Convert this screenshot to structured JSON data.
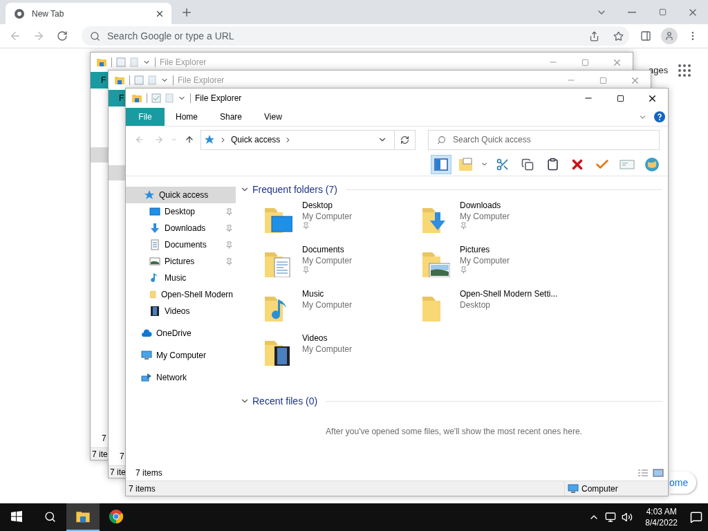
{
  "browser": {
    "tab": {
      "title": "New Tab"
    },
    "omnibox": {
      "placeholder": "Search Google or type a URL"
    }
  },
  "page": {
    "link_fragment": "ages",
    "button_fragment": "ome"
  },
  "back_windows": [
    {
      "title": "File Explorer",
      "tab": "F",
      "item_count": "7",
      "status": "7 ite"
    },
    {
      "title": "File Explorer",
      "tab": "F",
      "item_count": "7",
      "status": "7 ite"
    }
  ],
  "window": {
    "title": "File Explorer",
    "ribbon_tabs": [
      {
        "label": "File",
        "selected": true
      },
      {
        "label": "Home",
        "selected": false
      },
      {
        "label": "Share",
        "selected": false
      },
      {
        "label": "View",
        "selected": false
      }
    ],
    "address": {
      "path": "Quick access"
    },
    "search": {
      "placeholder": "Search Quick access"
    },
    "preview_pane": {
      "on": true
    },
    "nav": [
      {
        "label": "Quick access",
        "kind": "star",
        "selected": true,
        "children": [
          {
            "label": "Desktop",
            "kind": "desktop",
            "pinned": true
          },
          {
            "label": "Downloads",
            "kind": "downloads",
            "pinned": true
          },
          {
            "label": "Documents",
            "kind": "documents",
            "pinned": true
          },
          {
            "label": "Pictures",
            "kind": "pictures",
            "pinned": true
          },
          {
            "label": "Music",
            "kind": "music",
            "pinned": false
          },
          {
            "label": "Open-Shell Modern",
            "kind": "folder",
            "pinned": false
          },
          {
            "label": "Videos",
            "kind": "videos",
            "pinned": false
          }
        ]
      },
      {
        "label": "OneDrive",
        "kind": "cloud",
        "selected": false
      },
      {
        "label": "My Computer",
        "kind": "computer",
        "selected": false
      },
      {
        "label": "Network",
        "kind": "network",
        "selected": false
      }
    ],
    "sections": [
      {
        "title": "Frequent folders (7)",
        "expanded": true,
        "folders": [
          {
            "name": "Desktop",
            "location": "My Computer",
            "kind": "desktop",
            "pinned": true
          },
          {
            "name": "Downloads",
            "location": "My Computer",
            "kind": "downloads",
            "pinned": true
          },
          {
            "name": "Documents",
            "location": "My Computer",
            "kind": "documents",
            "pinned": true
          },
          {
            "name": "Pictures",
            "location": "My Computer",
            "kind": "pictures",
            "pinned": true
          },
          {
            "name": "Music",
            "location": "My Computer",
            "kind": "music",
            "pinned": false
          },
          {
            "name": "Open-Shell Modern Setti...",
            "location": "Desktop",
            "kind": "folder",
            "pinned": false
          },
          {
            "name": "Videos",
            "location": "My Computer",
            "kind": "videos",
            "pinned": false
          }
        ]
      },
      {
        "title": "Recent files (0)",
        "expanded": true,
        "message": "After you've opened some files, we'll show the most recent ones here."
      }
    ],
    "item_count": "7 items",
    "status_bar": {
      "left": "7 items",
      "right": "Computer"
    }
  },
  "taskbar": {
    "apps": [
      {
        "kind": "explorer",
        "selected": true
      },
      {
        "kind": "chrome",
        "selected": false
      }
    ],
    "time": "4:03 AM",
    "date": "8/4/2022"
  }
}
